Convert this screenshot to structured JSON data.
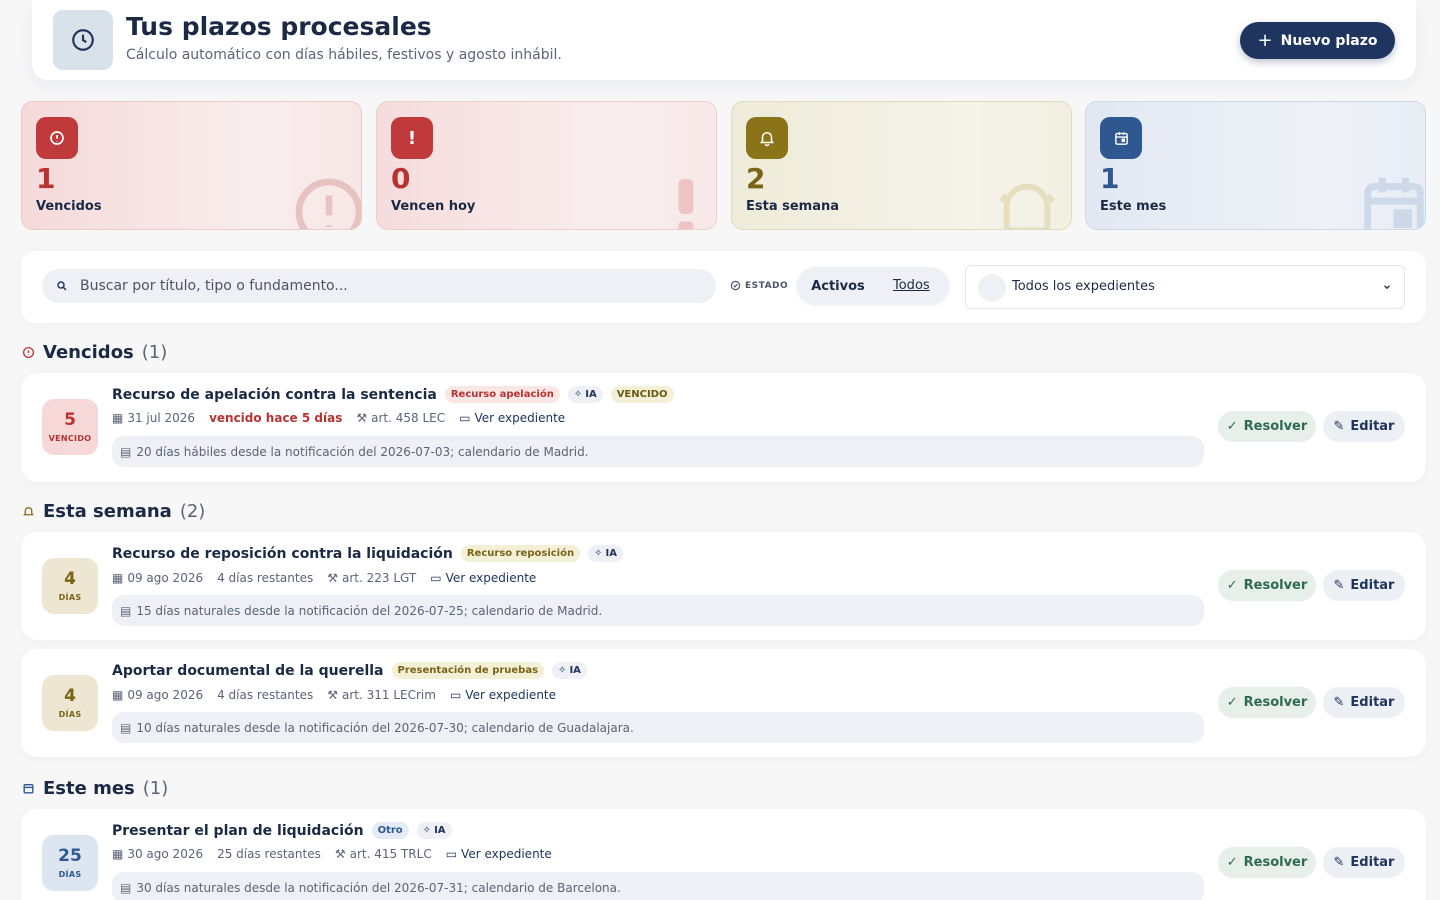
{
  "header": {
    "title": "Tus plazos procesales",
    "subtitle": "Cálculo automático con días hábiles, festivos y agosto inhábil.",
    "new_button": "Nuevo plazo",
    "logo_icon": "clock-icon"
  },
  "stats": [
    {
      "value": "1",
      "label": "Vencidos",
      "icon": "alert-circle-icon",
      "color": "#b83232"
    },
    {
      "value": "0",
      "label": "Vencen hoy",
      "icon": "exclamation-icon",
      "color": "#b83232"
    },
    {
      "value": "2",
      "label": "Esta semana",
      "icon": "bell-icon",
      "color": "#7a6416"
    },
    {
      "value": "1",
      "label": "Este mes",
      "icon": "calendar-icon",
      "color": "#2f5890"
    }
  ],
  "filters": {
    "search_placeholder": "Buscar por título, tipo o fundamento...",
    "estado_label": "ESTADO",
    "segment_active": "Activos",
    "segment_all": "Todos",
    "expedientes": "Todos los expedientes"
  },
  "sections": [
    {
      "title": "Vencidos",
      "count": "(1)"
    },
    {
      "title": "Esta semana",
      "count": "(2)"
    },
    {
      "title": "Este mes",
      "count": "(1)"
    }
  ],
  "items": [
    {
      "badge_num": "5",
      "badge_label": "VENCIDO",
      "title": "Recurso de apelación contra la sentencia",
      "type_tag": "Recurso apelación",
      "ia_tag": "IA",
      "status_tag": "VENCIDO",
      "date": "31 jul 2026",
      "remaining": "vencido hace 5 días",
      "article": "art. 458 LEC",
      "link": "Ver expediente",
      "note": "20 días hábiles desde la notificación del 2026-07-03; calendario de Madrid."
    },
    {
      "badge_num": "4",
      "badge_label": "DÍAS",
      "title": "Recurso de reposición contra la liquidación",
      "type_tag": "Recurso reposición",
      "ia_tag": "IA",
      "date": "09 ago 2026",
      "remaining": "4 días restantes",
      "article": "art. 223 LGT",
      "link": "Ver expediente",
      "note": "15 días naturales desde la notificación del 2026-07-25; calendario de Madrid."
    },
    {
      "badge_num": "4",
      "badge_label": "DÍAS",
      "title": "Aportar documental de la querella",
      "type_tag": "Presentación de pruebas",
      "ia_tag": "IA",
      "date": "09 ago 2026",
      "remaining": "4 días restantes",
      "article": "art. 311 LECrim",
      "link": "Ver expediente",
      "note": "10 días naturales desde la notificación del 2026-07-30; calendario de Guadalajara."
    },
    {
      "badge_num": "25",
      "badge_label": "DÍAS",
      "title": "Presentar el plan de liquidación",
      "type_tag": "Otro",
      "ia_tag": "IA",
      "date": "30 ago 2026",
      "remaining": "25 días restantes",
      "article": "art. 415 TRLC",
      "link": "Ver expediente",
      "note": "30 días naturales desde la notificación del 2026-07-31; calendario de Barcelona."
    }
  ],
  "actions": {
    "resolve": "Resolver",
    "edit": "Editar"
  }
}
